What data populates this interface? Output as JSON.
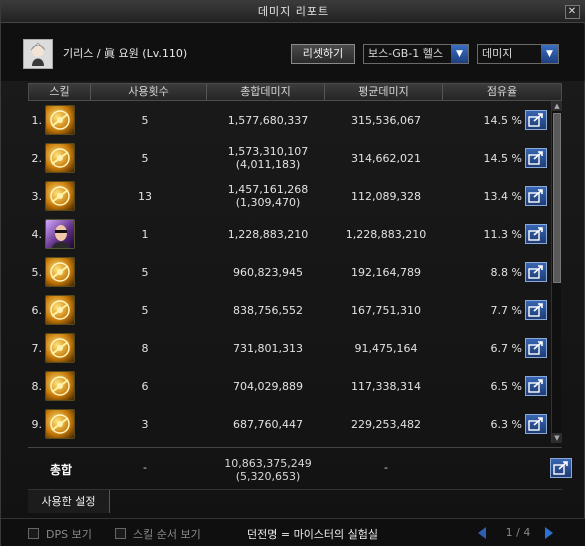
{
  "window": {
    "title": "데미지 리포트",
    "close": "✕"
  },
  "header": {
    "character": "기리스 / 眞 요원 (Lv.110)",
    "reset_label": "리셋하기",
    "boss_select": "보스-GB-1 헬스",
    "metric_select": "데미지"
  },
  "columns": {
    "skill": "스킬",
    "uses": "사용횟수",
    "total": "총합데미지",
    "avg": "평균데미지",
    "share": "점유율"
  },
  "rows": [
    {
      "idx": "1.",
      "icon": "gold-skill-icon",
      "uses": "5",
      "total": "1,577,680,337",
      "sub": "",
      "avg": "315,536,067",
      "share": "14.5 %"
    },
    {
      "idx": "2.",
      "icon": "gold-skill-icon",
      "uses": "5",
      "total": "1,573,310,107",
      "sub": "(4,011,183)",
      "avg": "314,662,021",
      "share": "14.5 %"
    },
    {
      "idx": "3.",
      "icon": "gold-skill-icon",
      "uses": "13",
      "total": "1,457,161,268",
      "sub": "(1,309,470)",
      "avg": "112,089,328",
      "share": "13.4 %"
    },
    {
      "idx": "4.",
      "icon": "portrait-skill-icon",
      "uses": "1",
      "total": "1,228,883,210",
      "sub": "",
      "avg": "1,228,883,210",
      "share": "11.3 %"
    },
    {
      "idx": "5.",
      "icon": "gold-skill-icon",
      "uses": "5",
      "total": "960,823,945",
      "sub": "",
      "avg": "192,164,789",
      "share": "8.8 %"
    },
    {
      "idx": "6.",
      "icon": "gold-skill-icon",
      "uses": "5",
      "total": "838,756,552",
      "sub": "",
      "avg": "167,751,310",
      "share": "7.7 %"
    },
    {
      "idx": "7.",
      "icon": "gold-skill-icon",
      "uses": "8",
      "total": "731,801,313",
      "sub": "",
      "avg": "91,475,164",
      "share": "6.7 %"
    },
    {
      "idx": "8.",
      "icon": "gold-skill-icon",
      "uses": "6",
      "total": "704,029,889",
      "sub": "",
      "avg": "117,338,314",
      "share": "6.5 %"
    },
    {
      "idx": "9.",
      "icon": "gold-skill-icon",
      "uses": "3",
      "total": "687,760,447",
      "sub": "",
      "avg": "229,253,482",
      "share": "6.3 %"
    }
  ],
  "summary": {
    "label": "총합",
    "uses": "-",
    "total": "10,863,375,249",
    "sub": "(5,320,653)",
    "avg": "-"
  },
  "tabs": {
    "used_settings": "사용한 설정"
  },
  "footer": {
    "dps_label": "DPS 보기",
    "order_label": "스킬 순서 보기",
    "dungeon": "던전명 = 마이스터의 실험실",
    "page": "1 / 4"
  },
  "colors": {
    "accent": "#2f5fb0",
    "gold": "#e8b53a",
    "background": "#121212"
  }
}
